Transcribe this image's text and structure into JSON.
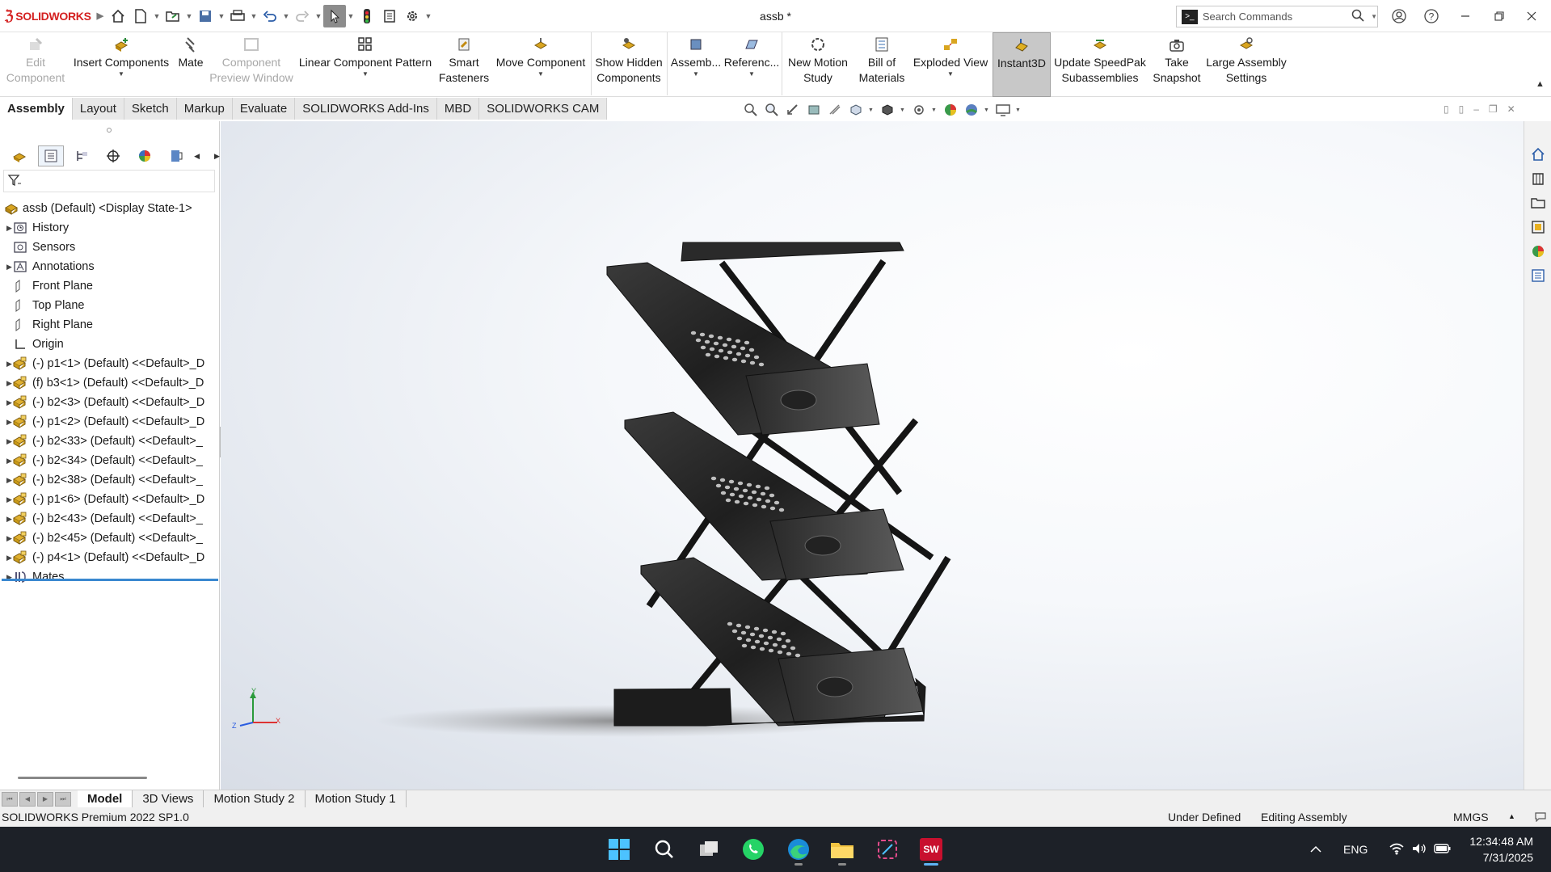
{
  "app": {
    "brand": "SOLIDWORKS",
    "document_title": "assb *",
    "search_placeholder": "Search Commands"
  },
  "commands": [
    {
      "label1": "Edit",
      "label2": "Component",
      "enabled": false,
      "icon": "edit-component-icon"
    },
    {
      "label1": "Insert Components",
      "label2": "",
      "enabled": true,
      "icon": "insert-components-icon",
      "dropdown": true
    },
    {
      "label1": "Mate",
      "label2": "",
      "enabled": true,
      "icon": "mate-icon"
    },
    {
      "label1": "Component",
      "label2": "Preview Window",
      "enabled": false,
      "icon": "component-preview-icon"
    },
    {
      "label1": "Linear Component Pattern",
      "label2": "",
      "enabled": true,
      "icon": "linear-pattern-icon",
      "dropdown": true
    },
    {
      "label1": "Smart",
      "label2": "Fasteners",
      "enabled": true,
      "icon": "smart-fasteners-icon"
    },
    {
      "label1": "Move Component",
      "label2": "",
      "enabled": true,
      "icon": "move-component-icon",
      "dropdown": true
    },
    {
      "label1": "Show Hidden",
      "label2": "Components",
      "enabled": true,
      "icon": "show-hidden-icon"
    },
    {
      "label1": "Assemb...",
      "label2": "",
      "enabled": true,
      "icon": "assembly-features-icon",
      "dropdown": true
    },
    {
      "label1": "Referenc...",
      "label2": "",
      "enabled": true,
      "icon": "reference-geometry-icon",
      "dropdown": true
    },
    {
      "label1": "New Motion",
      "label2": "Study",
      "enabled": true,
      "icon": "motion-study-icon"
    },
    {
      "label1": "Bill of",
      "label2": "Materials",
      "enabled": true,
      "icon": "bom-icon"
    },
    {
      "label1": "Exploded View",
      "label2": "",
      "enabled": true,
      "icon": "exploded-view-icon",
      "dropdown": true
    },
    {
      "label1": "Instant3D",
      "label2": "",
      "enabled": true,
      "icon": "instant3d-icon",
      "pressed": true
    },
    {
      "label1": "Update SpeedPak",
      "label2": "Subassemblies",
      "enabled": true,
      "icon": "speedpak-icon"
    },
    {
      "label1": "Take",
      "label2": "Snapshot",
      "enabled": true,
      "icon": "snapshot-icon"
    },
    {
      "label1": "Large Assembly",
      "label2": "Settings",
      "enabled": true,
      "icon": "large-assembly-icon"
    }
  ],
  "tabs": [
    "Assembly",
    "Layout",
    "Sketch",
    "Markup",
    "Evaluate",
    "SOLIDWORKS Add-Ins",
    "MBD",
    "SOLIDWORKS CAM"
  ],
  "active_tab": "Assembly",
  "tree": {
    "root": "assb (Default) <Display State-1>",
    "items": [
      {
        "label": "History",
        "icon": "history-icon",
        "expandable": true
      },
      {
        "label": "Sensors",
        "icon": "sensors-icon",
        "expandable": false
      },
      {
        "label": "Annotations",
        "icon": "annotations-icon",
        "expandable": true
      },
      {
        "label": "Front Plane",
        "icon": "plane-icon",
        "expandable": false
      },
      {
        "label": "Top Plane",
        "icon": "plane-icon",
        "expandable": false
      },
      {
        "label": "Right Plane",
        "icon": "plane-icon",
        "expandable": false
      },
      {
        "label": "Origin",
        "icon": "origin-icon",
        "expandable": false
      },
      {
        "label": "(-) p1<1> (Default) <<Default>_D",
        "icon": "part-icon",
        "expandable": true
      },
      {
        "label": "(f) b3<1> (Default) <<Default>_D",
        "icon": "part-icon",
        "expandable": true
      },
      {
        "label": "(-) b2<3> (Default) <<Default>_D",
        "icon": "part-icon",
        "expandable": true
      },
      {
        "label": "(-) p1<2> (Default) <<Default>_D",
        "icon": "part-icon",
        "expandable": true
      },
      {
        "label": "(-) b2<33> (Default) <<Default>_",
        "icon": "part-icon",
        "expandable": true
      },
      {
        "label": "(-) b2<34> (Default) <<Default>_",
        "icon": "part-icon",
        "expandable": true
      },
      {
        "label": "(-) b2<38> (Default) <<Default>_",
        "icon": "part-icon",
        "expandable": true
      },
      {
        "label": "(-) p1<6> (Default) <<Default>_D",
        "icon": "part-icon",
        "expandable": true
      },
      {
        "label": "(-) b2<43> (Default) <<Default>_",
        "icon": "part-icon",
        "expandable": true
      },
      {
        "label": "(-) b2<45> (Default) <<Default>_",
        "icon": "part-icon",
        "expandable": true
      },
      {
        "label": "(-) p4<1> (Default) <<Default>_D",
        "icon": "part-icon",
        "expandable": true
      },
      {
        "label": "Mates",
        "icon": "mates-icon",
        "expandable": true
      }
    ]
  },
  "triad": {
    "x": "X",
    "y": "Y",
    "z": "Z"
  },
  "bottom_tabs": [
    "Model",
    "3D Views",
    "Motion Study 2",
    "Motion Study 1"
  ],
  "active_bottom_tab": "Model",
  "status": {
    "version": "SOLIDWORKS Premium 2022 SP1.0",
    "definition": "Under Defined",
    "mode": "Editing Assembly",
    "units": "MMGS"
  },
  "taskbar": {
    "language": "ENG",
    "time": "12:34:48 AM",
    "date": "7/31/2025"
  },
  "colors": {
    "brand_red": "#d42020",
    "accent_blue": "#3a88d0",
    "model_dark": "#1c1c1c",
    "taskbar_bg": "#1d2128"
  }
}
